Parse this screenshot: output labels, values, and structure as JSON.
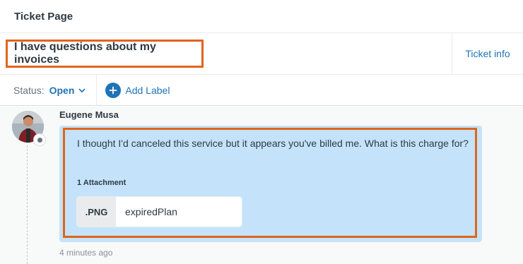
{
  "page": {
    "title": "Ticket Page"
  },
  "ticket": {
    "subject": "I have questions about my invoices",
    "info_link": "Ticket info"
  },
  "status_bar": {
    "status_label": "Status:",
    "status_value": "Open",
    "add_label": "Add Label"
  },
  "message": {
    "author": "Eugene Musa",
    "body": "I thought I'd canceled this service but it appears you've billed me. What is this charge for?",
    "attachments_label": "1 Attachment",
    "attachment": {
      "ext": ".PNG",
      "name": "expiredPlan"
    },
    "timestamp": "4 minutes ago"
  },
  "colors": {
    "accent": "#1f73b7",
    "highlight": "#e0651b",
    "bubble": "#c4e3fb"
  },
  "icons": [
    "chevron-down-icon",
    "plus-icon",
    "user-avatar",
    "avatar-status-icon"
  ]
}
